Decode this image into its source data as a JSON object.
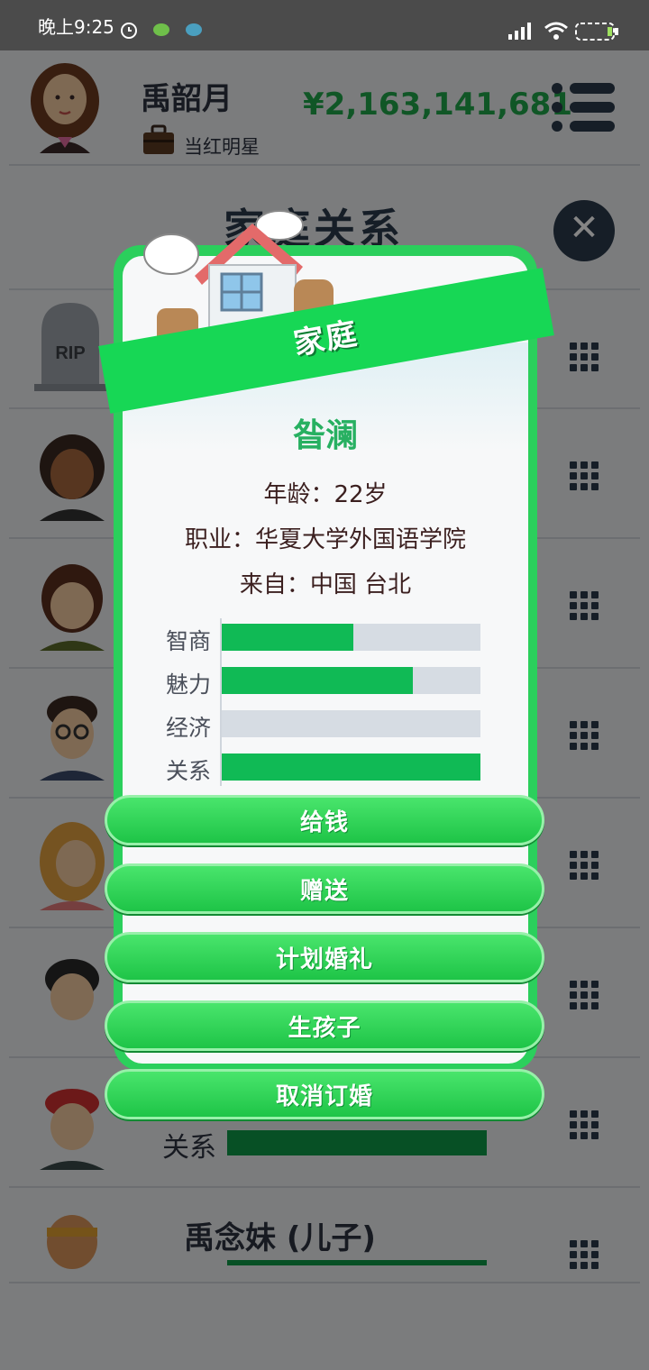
{
  "status_bar": {
    "time": "晚上9:25"
  },
  "header": {
    "name": "禹韶月",
    "job": "当红明星",
    "money": "¥2,163,141,681",
    "icons": [
      "portrait-avatar",
      "briefcase-icon",
      "menu-icon"
    ]
  },
  "section_title": "家庭关系",
  "background_list": {
    "rows": [
      {
        "avatar": "tombstone-icon",
        "avatar_text": "RIP"
      },
      {
        "avatar": "curly-hair-avatar"
      },
      {
        "avatar": "brown-hair-avatar"
      },
      {
        "avatar": "glasses-man-avatar"
      },
      {
        "avatar": "blonde-woman-avatar"
      },
      {
        "avatar": "boy-avatar"
      },
      {
        "avatar": "red-cap-avatar",
        "relation_label": "关系"
      },
      {
        "avatar": "headband-kid-avatar",
        "name": "禹念妹 (儿子)"
      }
    ]
  },
  "dialog": {
    "title": "家庭",
    "name": "昝澜",
    "age": "年龄：22岁",
    "occupation": "职业：华夏大学外国语学院",
    "origin": "来自：中国 台北",
    "stats": [
      {
        "label": "智商",
        "value": 0.51
      },
      {
        "label": "魅力",
        "value": 0.74
      },
      {
        "label": "经济",
        "value": 0.0
      },
      {
        "label": "关系",
        "value": 1.0
      }
    ],
    "actions": [
      "给钱",
      "赠送",
      "计划婚礼",
      "生孩子",
      "取消订婚"
    ]
  },
  "colors": {
    "accent_green": "#17d755",
    "money_green": "#1fa64a",
    "dark": "#2b3a4b"
  }
}
